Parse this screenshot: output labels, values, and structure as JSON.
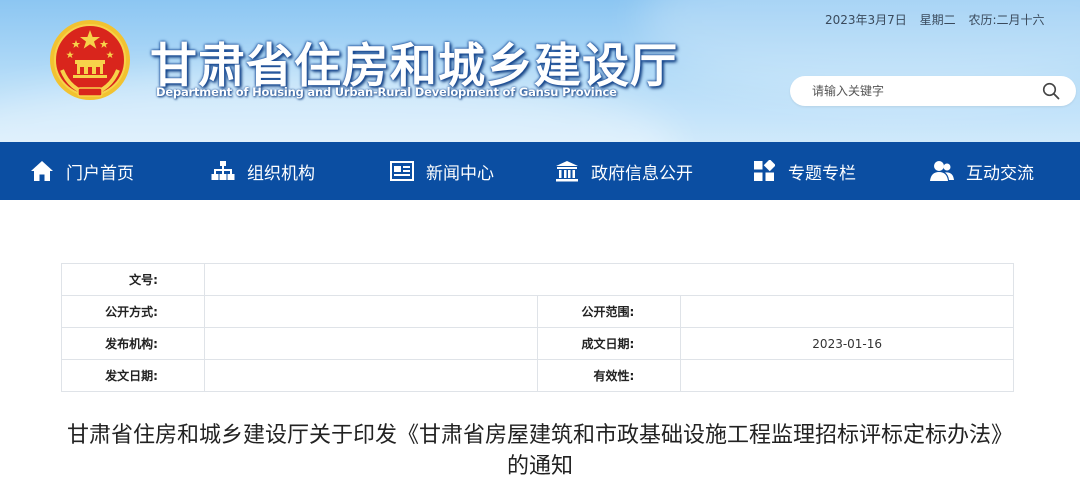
{
  "header": {
    "title": "甘肃省住房和城乡建设厅",
    "subtitle": "Department of Housing and Urban-Rural Development of Gansu Province",
    "date": "2023年3月7日",
    "weekday": "星期二",
    "lunar": "农历:二月十六",
    "emblem_icon": "national-emblem-icon",
    "colors": {
      "sky": "#8cc6f2",
      "title_outline": "#1c4f9b"
    }
  },
  "search": {
    "placeholder": "请输入关键字",
    "icon": "search-icon"
  },
  "nav": {
    "background": "#0b4ea2",
    "items": [
      {
        "label": "门户首页",
        "icon": "home-icon"
      },
      {
        "label": "组织机构",
        "icon": "org-chart-icon"
      },
      {
        "label": "新闻中心",
        "icon": "newspaper-icon"
      },
      {
        "label": "政府信息公开",
        "icon": "government-building-icon"
      },
      {
        "label": "专题专栏",
        "icon": "grid-icon"
      },
      {
        "label": "互动交流",
        "icon": "users-icon"
      }
    ]
  },
  "meta": {
    "rows": [
      {
        "k1": "文号:",
        "v1": ""
      },
      {
        "k1": "公开方式:",
        "v1": "",
        "k2": "公开范围:",
        "v2": ""
      },
      {
        "k1": "发布机构:",
        "v1": "",
        "k2": "成文日期:",
        "v2": "2023-01-16"
      },
      {
        "k1": "发文日期:",
        "v1": "",
        "k2": "有效性:",
        "v2": ""
      }
    ]
  },
  "article": {
    "title": "甘肃省住房和城乡建设厅关于印发《甘肃省房屋建筑和市政基础设施工程监理招标评标定标办法》的通知"
  }
}
